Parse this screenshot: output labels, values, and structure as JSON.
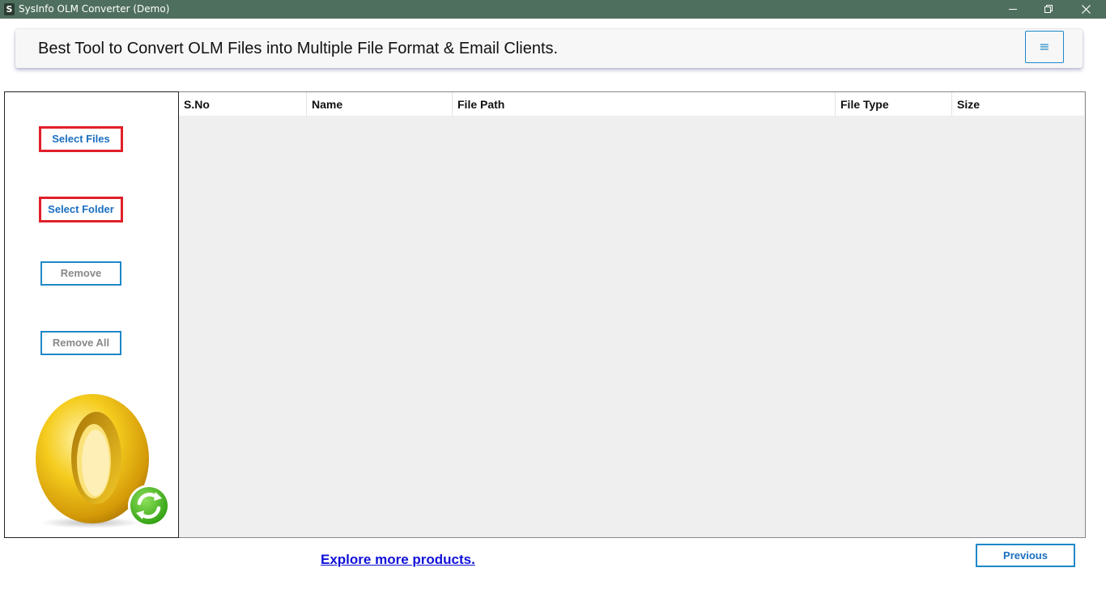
{
  "window": {
    "app_icon_letter": "S",
    "title": "SysInfo OLM Converter (Demo)"
  },
  "header": {
    "title": "Best Tool to Convert OLM Files into Multiple File Format & Email Clients.",
    "menu_icon": "hamburger-menu-icon",
    "menu_glyph": "≡"
  },
  "sidebar": {
    "select_files_label": "Select Files",
    "select_folder_label": "Select Folder",
    "remove_label": "Remove",
    "remove_all_label": "Remove All",
    "logo_icon": "outlook-mac-logo"
  },
  "table": {
    "columns": [
      "S.No",
      "Name",
      "File Path",
      "File Type",
      "Size"
    ],
    "rows": []
  },
  "footer": {
    "explore_link": "Explore more products.",
    "previous_label": "Previous"
  },
  "colors": {
    "titlebar": "#4f6f5e",
    "accent_blue": "#1e88c8",
    "highlight_red": "#e0202a",
    "link_blue": "#1010d8"
  }
}
